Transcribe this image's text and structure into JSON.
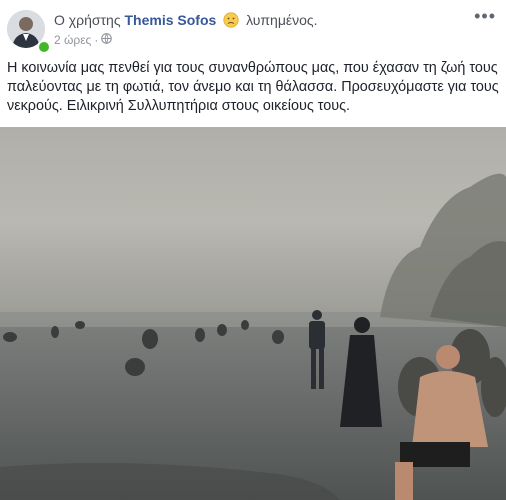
{
  "post": {
    "prefix": "Ο χρήστης",
    "author": "Themis Sofos",
    "feeling": "λυπημένος.",
    "time": "2 ώρες",
    "more_label": "•••",
    "text": "Η κοινωνία μας πενθεί για τους συνανθρώπους μας, που έχασαν τη ζωή τους παλεύοντας με τη φωτιά, τον άνεμο και τη θάλασσα. Προσευχόμαστε για τους νεκρούς. Ειλικρινή Συλλυπητήρια στους οικείους τους."
  },
  "icons": {
    "feeling": "sad-face-icon",
    "privacy": "globe-icon",
    "more": "more-options-icon"
  },
  "colors": {
    "author_link": "#365899",
    "online": "#42b72a",
    "meta_gray": "#90949c"
  }
}
